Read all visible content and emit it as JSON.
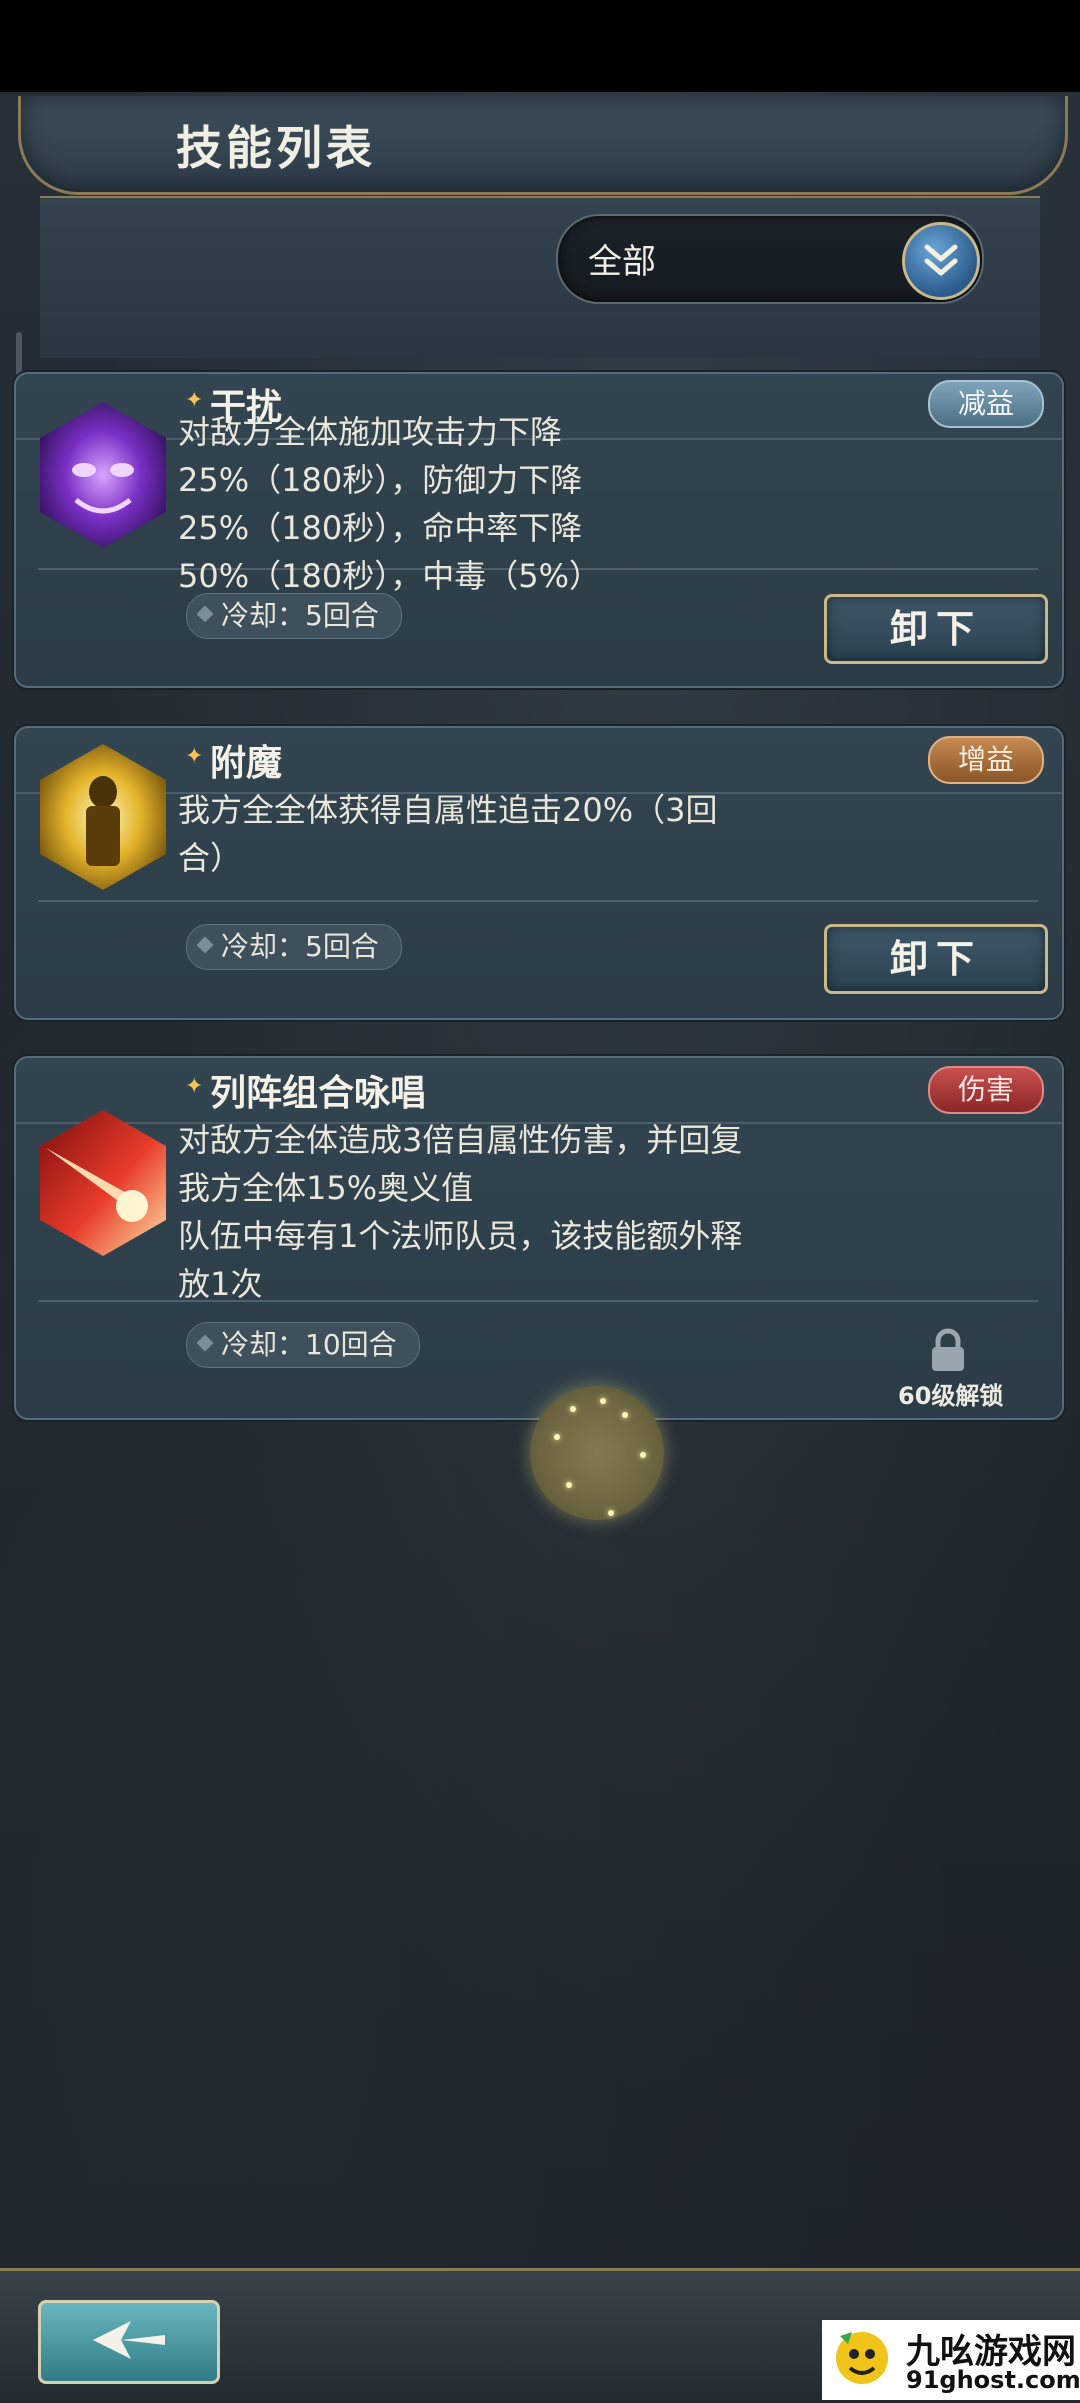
{
  "header": {
    "title": "技能列表",
    "filter_label": "全部"
  },
  "skills": [
    {
      "name": "干扰",
      "tag": "减益",
      "desc": [
        "对敌方全体施加攻击力下降",
        "25%（180秒），防御力下降",
        "25%（180秒），命中率下降",
        "50%（180秒），中毒（5%）"
      ],
      "cooldown": "冷却：5回合",
      "action": "卸下"
    },
    {
      "name": "附魔",
      "tag": "增益",
      "desc": [
        "我方全全体获得自属性追击20%（3回",
        "合）"
      ],
      "cooldown": "冷却：5回合",
      "action": "卸下"
    },
    {
      "name": "列阵组合咏唱",
      "tag": "伤害",
      "desc": [
        "对敌方全体造成3倍自属性伤害，并回复",
        "我方全体15%奥义值",
        "队伍中每有1个法师队员，该技能额外释",
        "放1次"
      ],
      "cooldown": "冷却：10回合",
      "lock_text": "60级解锁"
    }
  ],
  "watermark": {
    "name": "九吆游戏网",
    "url": "91ghost.com"
  },
  "colors": {
    "tag_debuff": "#5f8399",
    "tag_buff": "#a86c3a",
    "tag_damage": "#a73836",
    "button_border": "#c9b98a"
  },
  "icons": [
    "chevron-double-down-icon",
    "lock-icon",
    "back-arrow-icon",
    "diamond-icon"
  ]
}
